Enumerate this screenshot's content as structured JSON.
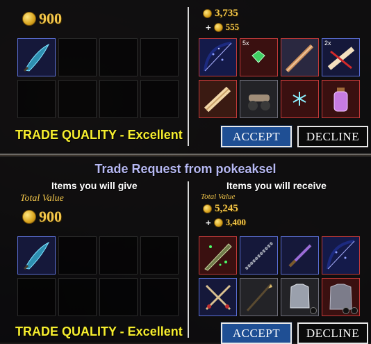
{
  "top_trade": {
    "give": {
      "total_value": "900",
      "items": [
        {
          "icon": "blue-scimitar",
          "rarity": "blue"
        }
      ]
    },
    "receive": {
      "total_value": "3,735",
      "secondary_value": "555",
      "plus": "+",
      "items": [
        {
          "icon": "dark-bow",
          "rarity": "red",
          "count": ""
        },
        {
          "icon": "green-gem",
          "rarity": "red",
          "count": "5x"
        },
        {
          "icon": "rod-bandit",
          "rarity": "red",
          "count": ""
        },
        {
          "icon": "red-scroll",
          "rarity": "blue",
          "count": "2x"
        },
        {
          "icon": "map-scroll",
          "rarity": "red",
          "count": ""
        },
        {
          "icon": "cannon",
          "rarity": "gray",
          "count": ""
        },
        {
          "icon": "ice-crystal",
          "rarity": "red",
          "count": ""
        },
        {
          "icon": "purple-potion",
          "rarity": "red",
          "count": ""
        }
      ]
    },
    "quality_label": "TRADE QUALITY - Excellent",
    "accept_label": "ACCEPT",
    "decline_label": "DECLINE"
  },
  "bottom_trade": {
    "title": "Trade Request from pokeaksel",
    "give_heading": "Items you will give",
    "receive_heading": "Items you will receive",
    "give": {
      "total_value_label": "Total Value",
      "total_value": "900",
      "items": [
        {
          "icon": "blue-scimitar",
          "rarity": "blue"
        }
      ]
    },
    "receive": {
      "total_value_label": "Total Value",
      "total_value": "5,245",
      "secondary_value": "3,400",
      "plus": "+",
      "items": [
        {
          "icon": "green-blade",
          "rarity": "red"
        },
        {
          "icon": "spiked-spear",
          "rarity": "blue"
        },
        {
          "icon": "purple-dagger",
          "rarity": "blue"
        },
        {
          "icon": "dark-bow",
          "rarity": "red"
        },
        {
          "icon": "twin-swords",
          "rarity": "blue"
        },
        {
          "icon": "staff-spear",
          "rarity": "gray"
        },
        {
          "icon": "plate-armor",
          "rarity": "gray"
        },
        {
          "icon": "chain-shirt",
          "rarity": "red"
        }
      ]
    },
    "quality_label": "TRADE QUALITY - Excellent",
    "accept_label": "ACCEPT",
    "decline_label": "DECLINE"
  },
  "colors": {
    "quality": "#f6ee2e",
    "title": "#b6b8f2",
    "gold": "#f3c64a",
    "accept": "#1f4f94"
  }
}
